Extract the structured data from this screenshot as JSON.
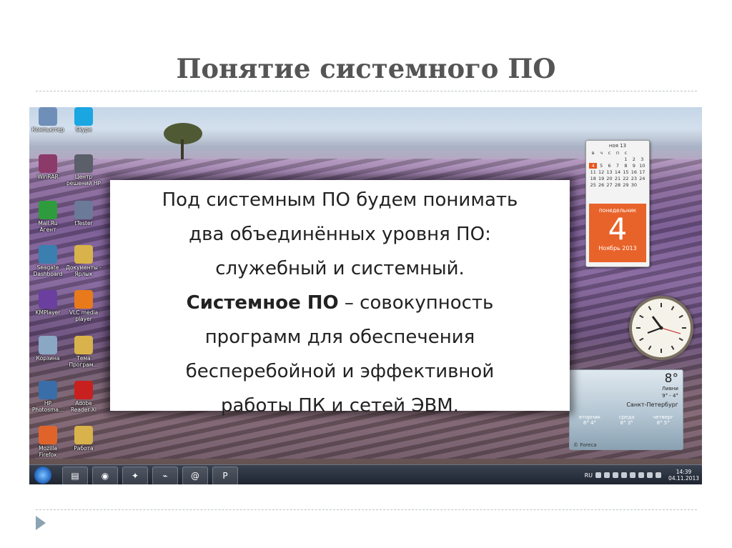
{
  "slide": {
    "title": "Понятие системного ПО"
  },
  "desktop_icons": [
    {
      "label": "Компьютер",
      "icon": "computer-icon",
      "color": "#6f8fb8"
    },
    {
      "label": "Skype",
      "icon": "skype-icon",
      "color": "#1aa6e0"
    },
    {
      "label": "WinRAR",
      "icon": "winrar-icon",
      "color": "#8c3a6a"
    },
    {
      "label": "Центр решений HP",
      "icon": "hp-icon",
      "color": "#5a5f6a"
    },
    {
      "label": "Mail.Ru Агент",
      "icon": "mail-agent-icon",
      "color": "#2e9c3c"
    },
    {
      "label": "tTester",
      "icon": "ttester-icon",
      "color": "#6b7a98"
    },
    {
      "label": "Seagate Dashboard",
      "icon": "seagate-icon",
      "color": "#3a7fb0"
    },
    {
      "label": "Документы - Ярлык",
      "icon": "folder-icon",
      "color": "#d8b24a"
    },
    {
      "label": "KMPlayer",
      "icon": "kmplayer-icon",
      "color": "#6a3fa0"
    },
    {
      "label": "VLC media player",
      "icon": "vlc-icon",
      "color": "#e87a1c"
    },
    {
      "label": "Корзина",
      "icon": "recycle-bin-icon",
      "color": "#8aa7c4"
    },
    {
      "label": "Тема Програм...",
      "icon": "document-icon",
      "color": "#d8b24a"
    },
    {
      "label": "HP Photosma...",
      "icon": "hp-photosmart-icon",
      "color": "#3a6ea8"
    },
    {
      "label": "Adobe Reader XI",
      "icon": "adobe-reader-icon",
      "color": "#c8201e"
    },
    {
      "label": "Mozilla Firefox",
      "icon": "firefox-icon",
      "color": "#e0642a"
    },
    {
      "label": "Работа",
      "icon": "folder-icon",
      "color": "#d8b24a"
    }
  ],
  "textbox": {
    "line1": "Под системным ПО будем понимать",
    "line2": "два объединённых уровня ПО:",
    "line3": "служебный и системный.",
    "bold_term": "Системное ПО",
    "line4_rest": " – совокупность",
    "line5": "программ для обеспечения",
    "line6": "бесперебойной и эффективной",
    "line7": "работы ПК и сетей ЭВМ."
  },
  "calendar": {
    "month_nav": "ноя 13",
    "weekdays": [
      "в",
      "ч",
      "с",
      "п",
      "с"
    ],
    "rows": [
      [
        "",
        "",
        "",
        "1",
        "2",
        "3"
      ],
      [
        "4",
        "5",
        "6",
        "7",
        "8",
        "9",
        "10"
      ],
      [
        "11",
        "12",
        "13",
        "14",
        "15",
        "16",
        "17"
      ],
      [
        "18",
        "19",
        "20",
        "21",
        "22",
        "23",
        "24"
      ],
      [
        "25",
        "26",
        "27",
        "28",
        "29",
        "30",
        ""
      ]
    ],
    "weekday_name": "понедельник",
    "day_number": "4",
    "month_year": "Ноябрь 2013",
    "accent": "#e8632a"
  },
  "weather": {
    "temperature": "8°",
    "condition": "Ливни",
    "range": "9° - 4°",
    "city": "Санкт-Петербург",
    "forecast": [
      {
        "day": "вторник",
        "high": "8°",
        "low": "4°"
      },
      {
        "day": "среда",
        "high": "8°",
        "low": "3°"
      },
      {
        "day": "четверг",
        "high": "8°",
        "low": "5°"
      }
    ],
    "source": "© Foreca"
  },
  "taskbar": {
    "apps": [
      {
        "icon": "explorer-folder-icon",
        "glyph": "▤"
      },
      {
        "icon": "firefox-icon",
        "glyph": "◉"
      },
      {
        "icon": "control-panel-icon",
        "glyph": "✦"
      },
      {
        "icon": "network-icon",
        "glyph": "⌁"
      },
      {
        "icon": "mail-agent-icon",
        "glyph": "@"
      },
      {
        "icon": "powerpoint-icon",
        "glyph": "P"
      }
    ],
    "language": "RU",
    "time": "14:39",
    "date": "04.11.2013"
  }
}
